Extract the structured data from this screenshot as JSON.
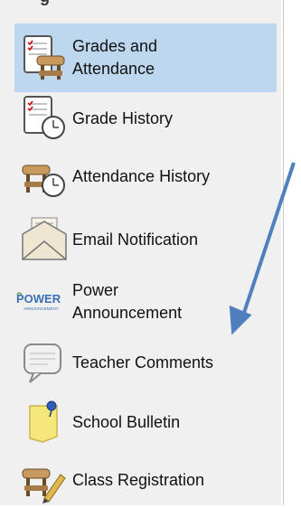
{
  "sidebar": {
    "section_title_fragment": "g",
    "items": [
      {
        "line1": "Grades and",
        "line2": "Attendance",
        "icon": "grades-attendance-icon",
        "active": true
      },
      {
        "line1": "Grade History",
        "line2": "",
        "icon": "grade-history-icon",
        "active": false
      },
      {
        "line1": "Attendance History",
        "line2": "",
        "icon": "attendance-history-icon",
        "active": false
      },
      {
        "line1": "Email Notification",
        "line2": "",
        "icon": "email-icon",
        "active": false
      },
      {
        "line1": "Power",
        "line2": "Announcement",
        "icon": "power-announcement-logo",
        "active": false
      },
      {
        "line1": "Teacher Comments",
        "line2": "",
        "icon": "speech-bubble-icon",
        "active": false
      },
      {
        "line1": "School Bulletin",
        "line2": "",
        "icon": "sticky-note-icon",
        "active": false
      },
      {
        "line1": "Class Registration",
        "line2": "",
        "icon": "desk-pencil-icon",
        "active": false
      }
    ]
  },
  "logo": {
    "power_text": "POWER",
    "sub_text": "ANNOUNCEMENT"
  },
  "colors": {
    "active_background": "#bcd7ee",
    "sidebar_background": "#f0f0f0",
    "arrow": "#4f7fbd"
  }
}
